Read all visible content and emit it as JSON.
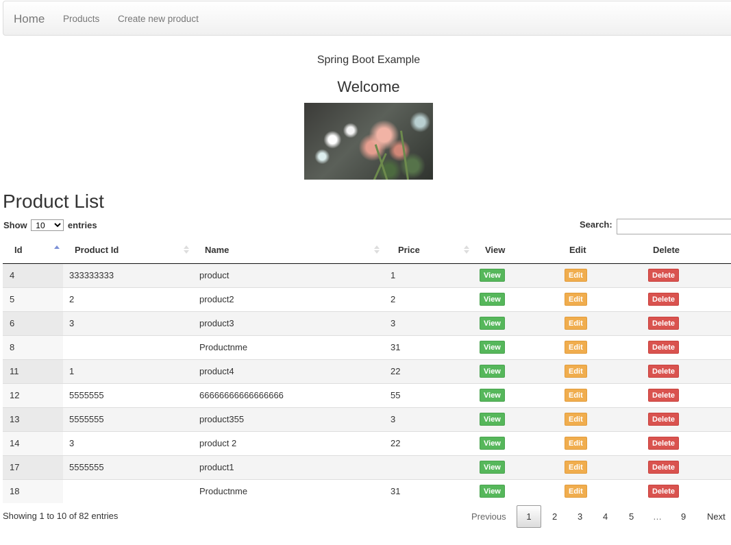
{
  "nav": {
    "brand": "Home",
    "links": [
      "Products",
      "Create new product"
    ]
  },
  "header": {
    "subtitle": "Spring Boot Example",
    "welcome": "Welcome"
  },
  "page_title": "Product List",
  "length_control": {
    "show_label": "Show",
    "value": "10",
    "entries_label": "entries"
  },
  "search": {
    "label": "Search:",
    "value": ""
  },
  "table": {
    "columns": [
      "Id",
      "Product Id",
      "Name",
      "Price",
      "View",
      "Edit",
      "Delete"
    ],
    "sort_column": "Id",
    "sort_direction": "ascending",
    "rows": [
      {
        "id": "4",
        "product_id": "333333333",
        "name": "product",
        "price": "1"
      },
      {
        "id": "5",
        "product_id": "2",
        "name": "product2",
        "price": "2"
      },
      {
        "id": "6",
        "product_id": "3",
        "name": "product3",
        "price": "3"
      },
      {
        "id": "8",
        "product_id": "",
        "name": "Productnme",
        "price": "31"
      },
      {
        "id": "11",
        "product_id": "1",
        "name": "product4",
        "price": "22"
      },
      {
        "id": "12",
        "product_id": "5555555",
        "name": "66666666666666666",
        "price": "55"
      },
      {
        "id": "13",
        "product_id": "5555555",
        "name": "product355",
        "price": "3"
      },
      {
        "id": "14",
        "product_id": "3",
        "name": "product 2",
        "price": "22"
      },
      {
        "id": "17",
        "product_id": "5555555",
        "name": "product1",
        "price": ""
      },
      {
        "id": "18",
        "product_id": "",
        "name": "Productnme",
        "price": "31"
      }
    ],
    "buttons": {
      "view": "View",
      "edit": "Edit",
      "delete": "Delete"
    }
  },
  "footer": {
    "info": "Showing 1 to 10 of 82 entries",
    "previous": "Previous",
    "pages": [
      "1",
      "2",
      "3",
      "4",
      "5",
      "…",
      "9"
    ],
    "current_page": "1",
    "next": "Next"
  },
  "colors": {
    "view": "#56b75b",
    "edit": "#f0ad4e",
    "delete": "#d9534f",
    "sort_active": "#7b8fd6"
  }
}
